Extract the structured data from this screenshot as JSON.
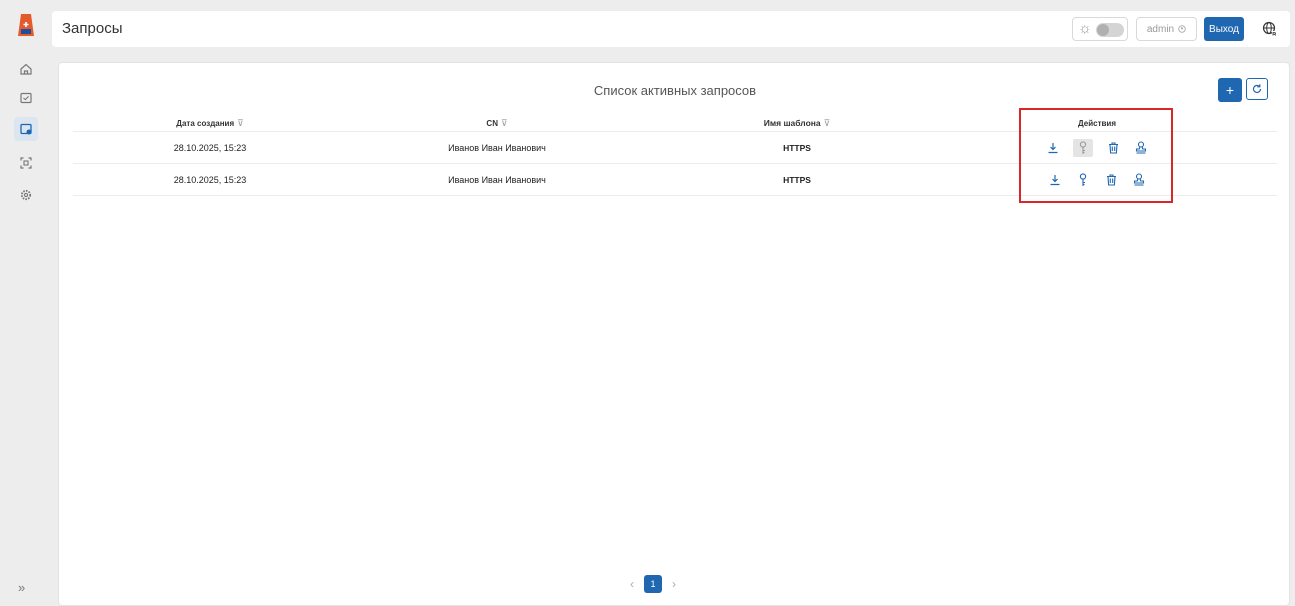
{
  "sidebar": {
    "items": [
      {
        "icon": "home-icon"
      },
      {
        "icon": "certificate-icon"
      },
      {
        "icon": "requests-icon",
        "active": true
      },
      {
        "icon": "scan-icon"
      },
      {
        "icon": "settings-icon"
      }
    ],
    "expand_label": "»"
  },
  "header": {
    "title": "Запросы",
    "user": "admin",
    "logout_label": "Выход",
    "accent": "#1f67b1"
  },
  "main": {
    "title": "Список активных запросов",
    "add_label": "+",
    "columns": [
      {
        "label": "Дата создания",
        "filter": true
      },
      {
        "label": "CN",
        "filter": true
      },
      {
        "label": "Имя шаблона",
        "filter": true
      },
      {
        "label": "Действия",
        "filter": false
      }
    ],
    "rows": [
      {
        "date": "28.10.2025, 15:23",
        "cn": "Иванов Иван Иванович",
        "template": "HTTPS",
        "key_disabled": true
      },
      {
        "date": "28.10.2025, 15:23",
        "cn": "Иванов Иван Иванович",
        "template": "HTTPS",
        "key_disabled": false
      }
    ],
    "actions": [
      "download-icon",
      "key-icon",
      "delete-icon",
      "sign-icon"
    ]
  },
  "pagination": {
    "current": "1",
    "prev": "‹",
    "next": "›"
  }
}
